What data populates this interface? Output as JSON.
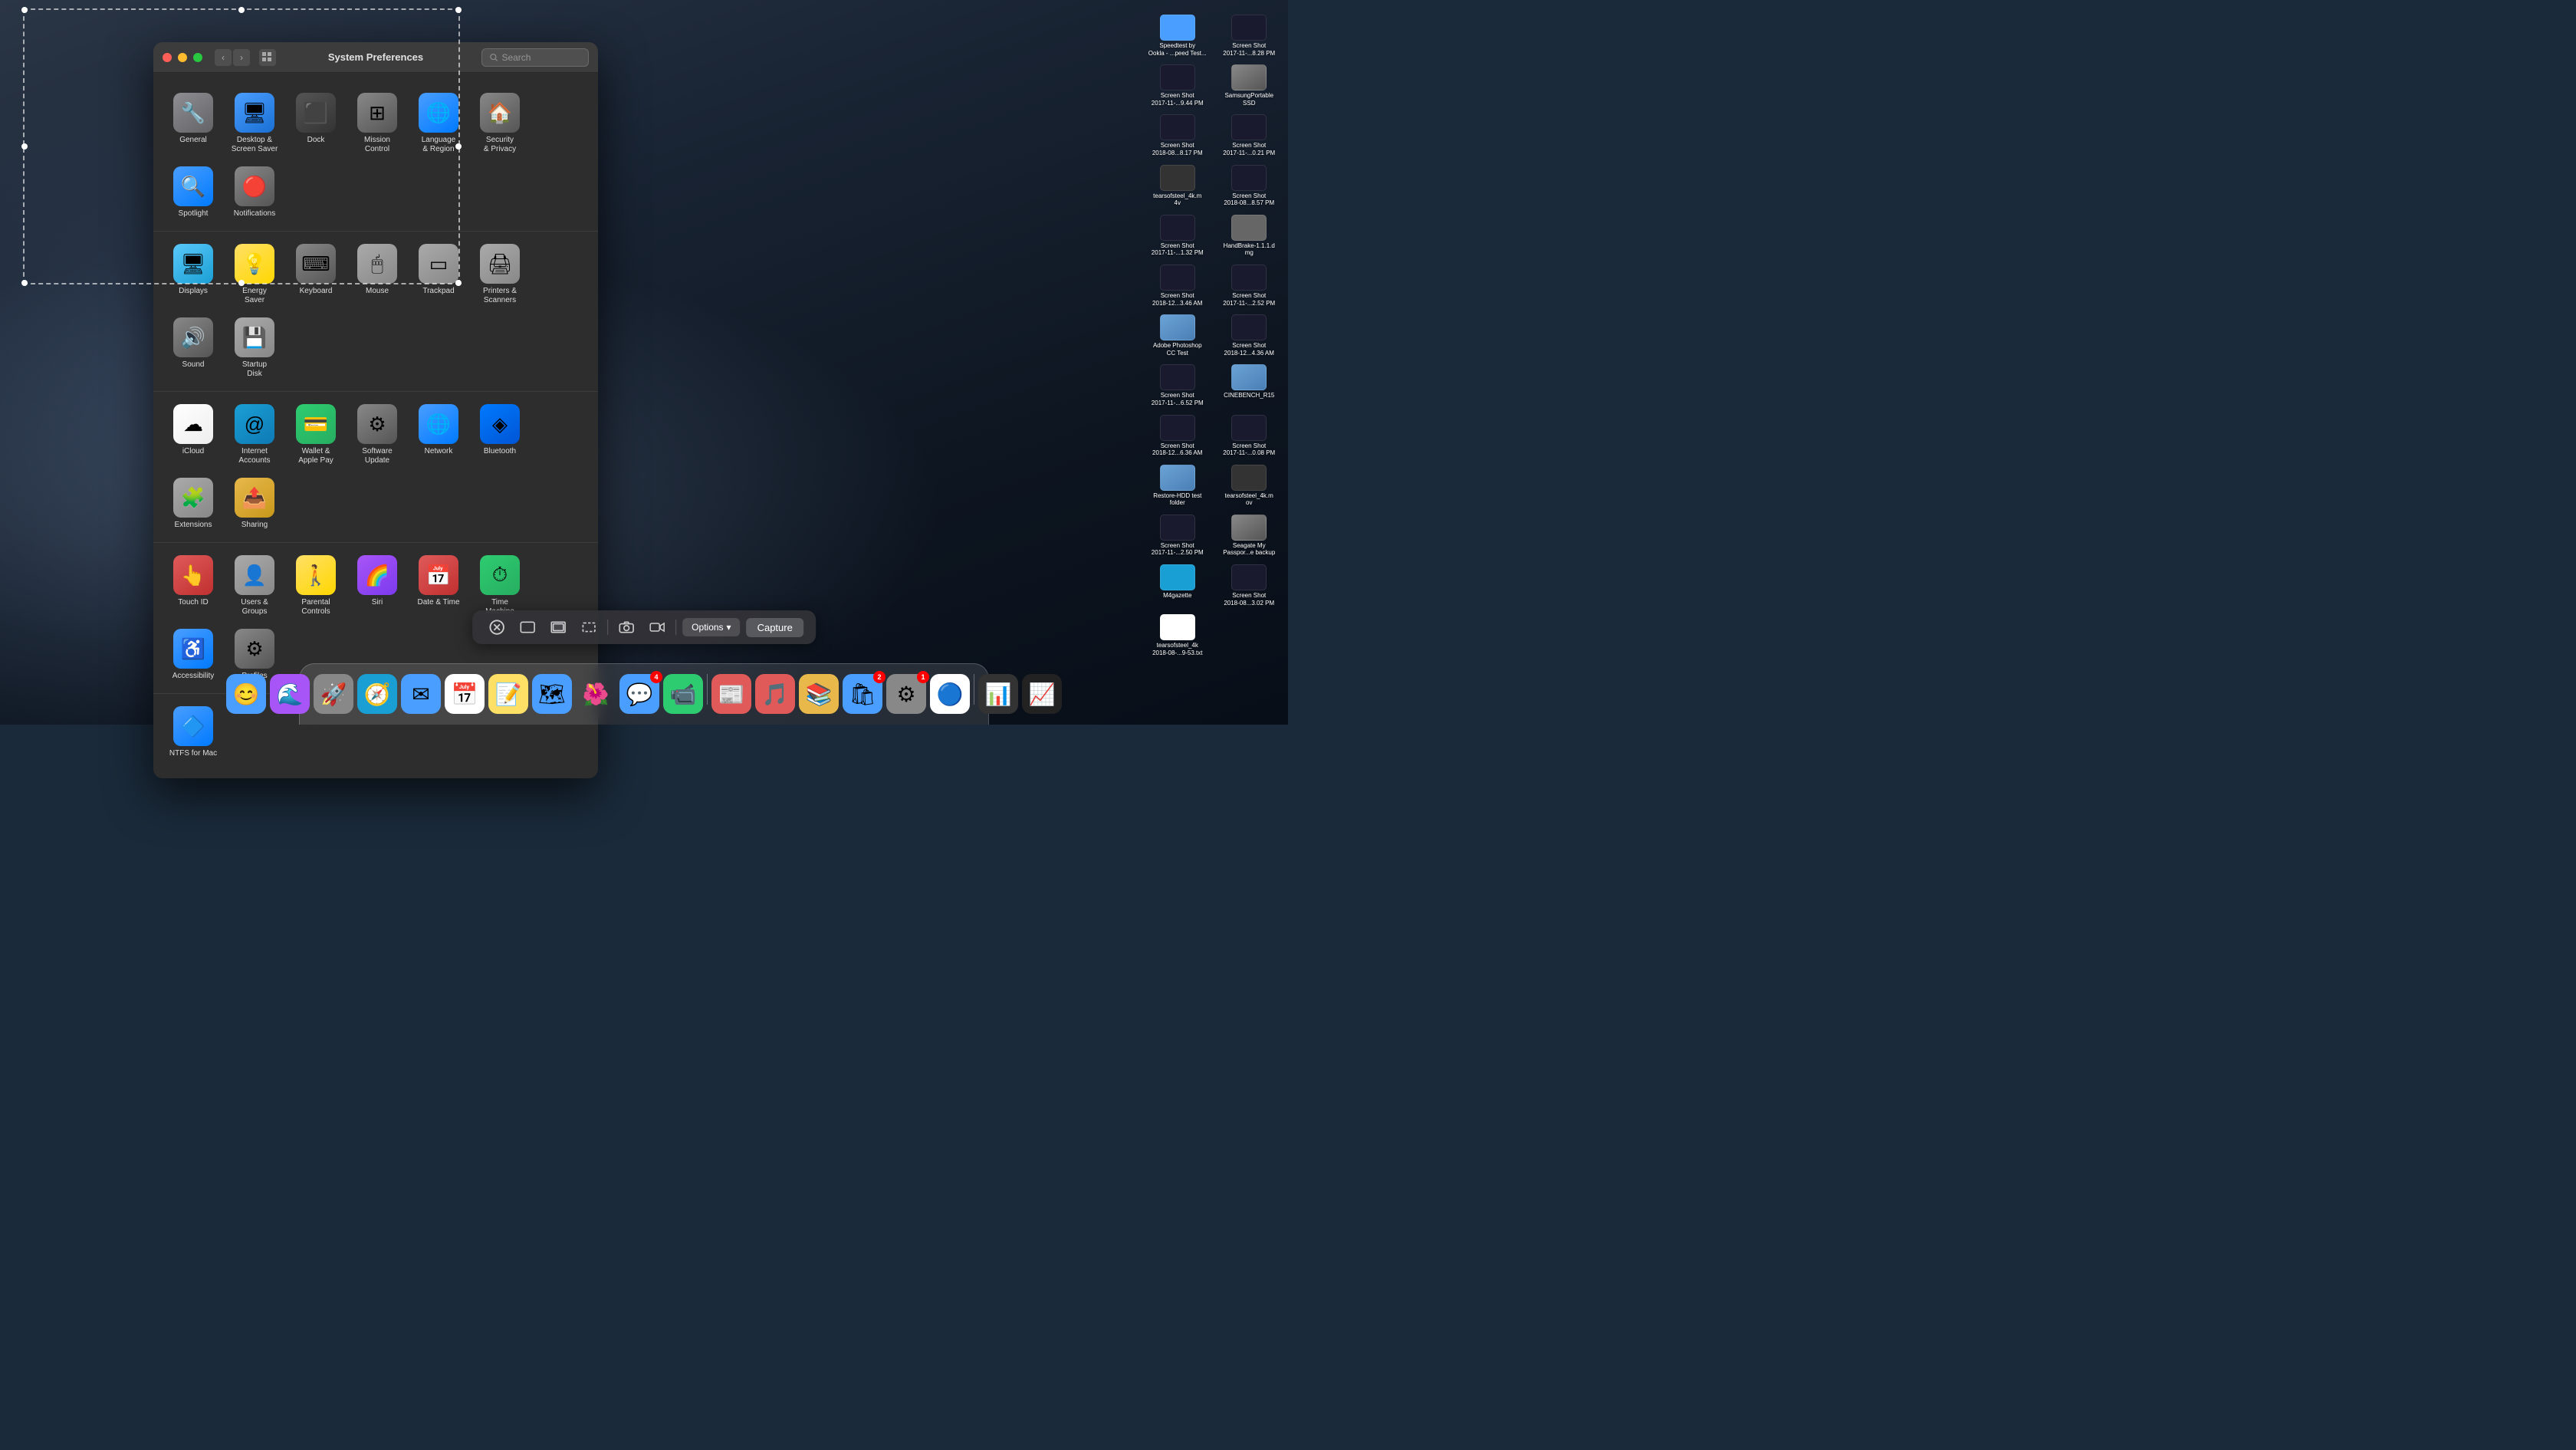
{
  "window": {
    "title": "System Preferences",
    "search_placeholder": "Search"
  },
  "sections": [
    {
      "id": "personal",
      "items": [
        {
          "id": "general",
          "label": "General",
          "icon": "🔧",
          "iconClass": "icon-general"
        },
        {
          "id": "desktop",
          "label": "Desktop &\nScreen Saver",
          "icon": "🖥",
          "iconClass": "icon-desktop"
        },
        {
          "id": "dock",
          "label": "Dock",
          "icon": "⬛",
          "iconClass": "icon-dock"
        },
        {
          "id": "mission",
          "label": "Mission\nControl",
          "icon": "⊞",
          "iconClass": "icon-mission"
        },
        {
          "id": "language",
          "label": "Language\n& Region",
          "icon": "🌐",
          "iconClass": "icon-language"
        },
        {
          "id": "security",
          "label": "Security\n& Privacy",
          "icon": "🏠",
          "iconClass": "icon-security"
        },
        {
          "id": "spotlight",
          "label": "Spotlight",
          "icon": "🔍",
          "iconClass": "icon-spotlight"
        },
        {
          "id": "notifications",
          "label": "Notifications",
          "icon": "🔴",
          "iconClass": "icon-notifications"
        }
      ]
    },
    {
      "id": "hardware",
      "items": [
        {
          "id": "displays",
          "label": "Displays",
          "icon": "🖥",
          "iconClass": "icon-displays"
        },
        {
          "id": "energy",
          "label": "Energy\nSaver",
          "icon": "💡",
          "iconClass": "icon-energy"
        },
        {
          "id": "keyboard",
          "label": "Keyboard",
          "icon": "⌨",
          "iconClass": "icon-keyboard"
        },
        {
          "id": "mouse",
          "label": "Mouse",
          "icon": "🖱",
          "iconClass": "icon-mouse"
        },
        {
          "id": "trackpad",
          "label": "Trackpad",
          "icon": "▭",
          "iconClass": "icon-trackpad"
        },
        {
          "id": "printers",
          "label": "Printers &\nScanners",
          "icon": "🖨",
          "iconClass": "icon-printers"
        },
        {
          "id": "sound",
          "label": "Sound",
          "icon": "🔊",
          "iconClass": "icon-sound"
        },
        {
          "id": "startup",
          "label": "Startup\nDisk",
          "icon": "💾",
          "iconClass": "icon-startup"
        }
      ]
    },
    {
      "id": "internet",
      "items": [
        {
          "id": "icloud",
          "label": "iCloud",
          "icon": "☁",
          "iconClass": "icon-icloud"
        },
        {
          "id": "internet",
          "label": "Internet\nAccounts",
          "icon": "@",
          "iconClass": "icon-internet"
        },
        {
          "id": "wallet",
          "label": "Wallet &\nApple Pay",
          "icon": "💳",
          "iconClass": "icon-wallet"
        },
        {
          "id": "software",
          "label": "Software\nUpdate",
          "icon": "⚙",
          "iconClass": "icon-software"
        },
        {
          "id": "network",
          "label": "Network",
          "icon": "🌐",
          "iconClass": "icon-network"
        },
        {
          "id": "bluetooth",
          "label": "Bluetooth",
          "icon": "◈",
          "iconClass": "icon-bluetooth"
        },
        {
          "id": "extensions",
          "label": "Extensions",
          "icon": "🧩",
          "iconClass": "icon-extensions"
        },
        {
          "id": "sharing",
          "label": "Sharing",
          "icon": "📤",
          "iconClass": "icon-sharing"
        }
      ]
    },
    {
      "id": "system",
      "items": [
        {
          "id": "touchid",
          "label": "Touch ID",
          "icon": "👆",
          "iconClass": "icon-touchid"
        },
        {
          "id": "users",
          "label": "Users &\nGroups",
          "icon": "👤",
          "iconClass": "icon-users"
        },
        {
          "id": "parental",
          "label": "Parental\nControls",
          "icon": "🚶",
          "iconClass": "icon-parental"
        },
        {
          "id": "siri",
          "label": "Siri",
          "icon": "🌈",
          "iconClass": "icon-siri"
        },
        {
          "id": "datetime",
          "label": "Date & Time",
          "icon": "📅",
          "iconClass": "icon-datetime"
        },
        {
          "id": "timemachine",
          "label": "Time\nMachine",
          "icon": "⏱",
          "iconClass": "icon-timemachine"
        },
        {
          "id": "accessibility",
          "label": "Accessibility",
          "icon": "♿",
          "iconClass": "icon-accessibility"
        },
        {
          "id": "profiles",
          "label": "Profiles",
          "icon": "⚙",
          "iconClass": "icon-profiles"
        }
      ]
    },
    {
      "id": "other",
      "items": [
        {
          "id": "ntfs",
          "label": "NTFS for Mac",
          "icon": "🔷",
          "iconClass": "icon-ntfs"
        }
      ]
    }
  ],
  "toolbar": {
    "options_label": "Options",
    "capture_label": "Capture",
    "chevron": "▾"
  },
  "dock": {
    "items": [
      {
        "id": "finder",
        "label": "Finder",
        "emoji": "😊",
        "bg": "#4a9eff",
        "badge": null
      },
      {
        "id": "siri",
        "label": "Siri",
        "emoji": "🌊",
        "bg": "linear-gradient(135deg,#a855f7,#3b82f6)",
        "badge": null
      },
      {
        "id": "launchpad",
        "label": "Launchpad",
        "emoji": "🚀",
        "bg": "#888",
        "badge": null
      },
      {
        "id": "safari",
        "label": "Safari",
        "emoji": "🧭",
        "bg": "#1a9fd4",
        "badge": null
      },
      {
        "id": "mail",
        "label": "Mail",
        "emoji": "✉️",
        "bg": "#4a9eff",
        "badge": null
      },
      {
        "id": "calendar",
        "label": "Calendar",
        "emoji": "📅",
        "bg": "white",
        "badge": null
      },
      {
        "id": "notes",
        "label": "Notes",
        "emoji": "📝",
        "bg": "#ffe066",
        "badge": null
      },
      {
        "id": "maps",
        "label": "Maps",
        "emoji": "🗺",
        "bg": "#4a9eff",
        "badge": null
      },
      {
        "id": "photos",
        "label": "Photos",
        "emoji": "📸",
        "bg": "#fff",
        "badge": null
      },
      {
        "id": "messages",
        "label": "Messages",
        "emoji": "💬",
        "bg": "#4a9eff",
        "badge": "4"
      },
      {
        "id": "facetime",
        "label": "FaceTime",
        "emoji": "📹",
        "bg": "#2ecc71",
        "badge": null
      },
      {
        "id": "news",
        "label": "News",
        "emoji": "🗞",
        "bg": "red",
        "badge": null
      },
      {
        "id": "music",
        "label": "Music",
        "emoji": "🎵",
        "bg": "#e05a5a",
        "badge": null
      },
      {
        "id": "books",
        "label": "Books",
        "emoji": "📚",
        "bg": "#e8b84b",
        "badge": null
      },
      {
        "id": "appstore",
        "label": "App Store",
        "emoji": "🛍",
        "bg": "#4a9eff",
        "badge": "2"
      },
      {
        "id": "sysprefs",
        "label": "System Preferences",
        "emoji": "⚙",
        "bg": "#888",
        "badge": "1"
      },
      {
        "id": "chrome",
        "label": "Chrome",
        "emoji": "🔵",
        "bg": "#fff",
        "badge": null
      },
      {
        "id": "istatmenus",
        "label": "iStatMenus",
        "emoji": "📊",
        "bg": "#333",
        "badge": null
      },
      {
        "id": "istatmenus2",
        "label": "iStatMenus2",
        "emoji": "📈",
        "bg": "#222",
        "badge": null
      }
    ]
  },
  "file_panel": {
    "items": [
      {
        "label": "Speedtest by\nOokla - ...peed Test...",
        "type": "app"
      },
      {
        "label": "Screen Shot\n2017-11-...8.28 PM",
        "type": "screenshot"
      },
      {
        "label": "Screen Shot\n2017-11-...9.44 PM",
        "type": "screenshot"
      },
      {
        "label": "SamsungPortable\nSSD",
        "type": "drive"
      },
      {
        "label": "Screen Shot\n2018-08...8.17 PM",
        "type": "screenshot"
      },
      {
        "label": "Screen Shot\n2017-11-...0.21 PM",
        "type": "screenshot"
      },
      {
        "label": "tearsofsteel_4k.m\n4v",
        "type": "video"
      },
      {
        "label": "Screen Shot\n2018-08...8.57 PM",
        "type": "screenshot"
      },
      {
        "label": "Screen Shot\n2017-11-...1.32 PM",
        "type": "screenshot"
      },
      {
        "label": "HandBrake-1.1.1.d\nmg",
        "type": "dmg"
      },
      {
        "label": "Screen Shot\n2018-12...3.46 AM",
        "type": "screenshot"
      },
      {
        "label": "Screen Shot\n2017-11-...2.52 PM",
        "type": "screenshot"
      },
      {
        "label": "Adobe Photoshop\nCC Test",
        "type": "folder"
      },
      {
        "label": "Screen Shot\n2018-12...4.36 AM",
        "type": "screenshot"
      },
      {
        "label": "Screen Shot\n2017-11-...6.52 PM",
        "type": "screenshot"
      },
      {
        "label": "CINEBENCH_R15",
        "type": "folder"
      },
      {
        "label": "Screen Shot\n2018-12...6.36 AM",
        "type": "screenshot"
      },
      {
        "label": "Screen Shot\n2017-11-...0.08 PM",
        "type": "screenshot"
      },
      {
        "label": "Restore-HDD test\nfolder",
        "type": "folder"
      },
      {
        "label": "tearsofsteel_4k.m\nov",
        "type": "video"
      },
      {
        "label": "Screen Shot\n2017-11-...2.50 PM",
        "type": "screenshot"
      },
      {
        "label": "Seagate My\nPasspor...e backup",
        "type": "drive"
      },
      {
        "label": "M4gazette",
        "type": "safari"
      },
      {
        "label": "Screen Shot\n2018-08...3.02 PM",
        "type": "screenshot"
      },
      {
        "label": "tearsofsteel_4k\n2018-08-...9-53.txt",
        "type": "text"
      }
    ]
  }
}
